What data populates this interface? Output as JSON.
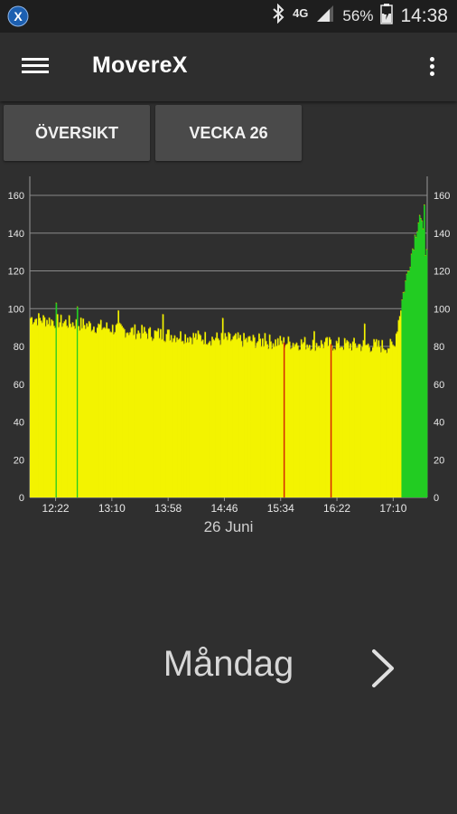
{
  "status_bar": {
    "app_notification_icon": "x-app-icon",
    "bluetooth_icon": "bluetooth-icon",
    "network_type": "4G",
    "signal_icon": "signal-icon",
    "battery_percent": "56%",
    "battery_icon": "battery-charging-icon",
    "time": "14:38"
  },
  "app_bar": {
    "menu_icon": "hamburger-menu-icon",
    "title": "MovereX",
    "overflow_icon": "more-vert-icon"
  },
  "tabs": [
    {
      "label": "ÖVERSIKT"
    },
    {
      "label": "VECKA 26"
    }
  ],
  "chart_data": {
    "type": "bar",
    "title": "",
    "xlabel": "26 Juni",
    "ylabel": "",
    "ylim": [
      0,
      160
    ],
    "y_ticks": [
      "0",
      "20",
      "40",
      "60",
      "80",
      "100",
      "120",
      "140",
      "160"
    ],
    "x_ticks": [
      "12:22",
      "13:10",
      "13:58",
      "14:46",
      "15:34",
      "16:22",
      "17:10"
    ],
    "x_tick_minutes": [
      742,
      790,
      838,
      886,
      934,
      982,
      1030
    ],
    "x_range_minutes": [
      720,
      1059
    ],
    "grid": true,
    "dual_y_axis": true,
    "colors": {
      "low": "#f3f300",
      "high": "#22cc22",
      "edge": "#b8a600",
      "marker": "#d72800"
    },
    "segments": [
      {
        "from": 720,
        "to": 760,
        "start": 95,
        "end": 92
      },
      {
        "from": 760,
        "to": 820,
        "start": 92,
        "end": 87
      },
      {
        "from": 820,
        "to": 880,
        "start": 87,
        "end": 84
      },
      {
        "from": 880,
        "to": 940,
        "start": 84,
        "end": 82
      },
      {
        "from": 940,
        "to": 1030,
        "start": 82,
        "end": 80
      },
      {
        "from": 1030,
        "to": 1038,
        "start": 80,
        "end": 108
      },
      {
        "from": 1038,
        "to": 1052,
        "start": 108,
        "end": 150
      },
      {
        "from": 1052,
        "to": 1059,
        "start": 150,
        "end": 125
      }
    ],
    "spikes": [
      {
        "t": 742,
        "value": 103
      },
      {
        "t": 760,
        "value": 101
      },
      {
        "t": 795,
        "value": 99
      },
      {
        "t": 833,
        "value": 97
      },
      {
        "t": 884,
        "value": 95
      },
      {
        "t": 920,
        "value": 87
      },
      {
        "t": 962,
        "value": 88
      },
      {
        "t": 1005,
        "value": 92
      },
      {
        "t": 1056,
        "value": 155
      }
    ],
    "marker_lines_minutes": [
      937,
      977
    ],
    "green_threshold": 100
  },
  "day_nav": {
    "day": "Måndag",
    "next_icon": "chevron-right-icon"
  }
}
